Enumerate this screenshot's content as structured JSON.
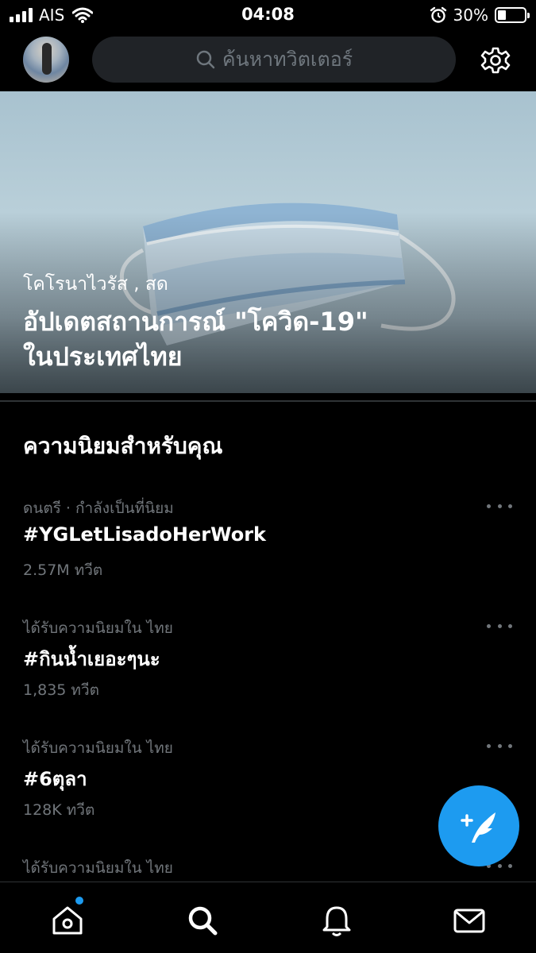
{
  "status_bar": {
    "carrier": "AIS",
    "time": "04:08",
    "battery_percent": "30%",
    "battery_level": 0.3
  },
  "header": {
    "search_placeholder": "ค้นหาทวิตเตอร์",
    "icons": [
      "avatar",
      "search-icon",
      "gear-icon"
    ]
  },
  "hero": {
    "category": "โคโรนาไวรัส , สด",
    "title_line1": "อัปเดตสถานการณ์ \"โควิด-19\"",
    "title_line2": "ในประเทศไทย"
  },
  "trends": {
    "section_title": "ความนิยมสำหรับคุณ",
    "items": [
      {
        "context": "ดนตรี · กำลังเป็นที่นิยม",
        "tag": "#YGLetLisadoHerWork",
        "count": "2.57M ทวีต"
      },
      {
        "context": "ได้รับความนิยมใน ไทย",
        "tag": "#กินน้ำเยอะๆนะ",
        "count": "1,835 ทวีต"
      },
      {
        "context": "ได้รับความนิยมใน ไทย",
        "tag": "#6ตุลา",
        "count": "128K ทวีต"
      },
      {
        "context": "ได้รับความนิยมใน ไทย",
        "tag": "",
        "count": ""
      }
    ]
  },
  "tab_bar": {
    "tabs": [
      "home-icon",
      "search-icon",
      "notifications-icon",
      "messages-icon"
    ],
    "home_has_badge": true
  },
  "colors": {
    "accent": "#1d9bf0",
    "background": "#000000",
    "secondary_text": "#71767b",
    "search_bg": "#202327"
  }
}
